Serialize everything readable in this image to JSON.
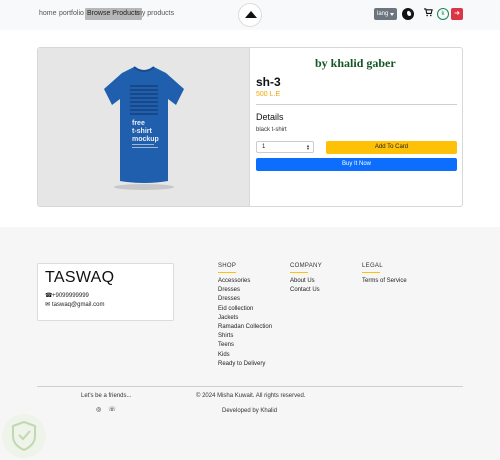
{
  "nav": {
    "links": [
      "home",
      "portfolio",
      "Browse Products",
      "my products"
    ],
    "lang_label": "lang",
    "k_label": "k"
  },
  "product": {
    "seller": "by khalid gaber",
    "title": "sh-3",
    "price": "500 L.E",
    "details_heading": "Details",
    "description": "black t-shirt",
    "quantity": "1",
    "add_to_cart": "Add To Card",
    "buy_now": "Buy It Now",
    "image_text": "free t-shirt mockup"
  },
  "footer": {
    "brand": "TASWAQ",
    "phone": "+9099999999",
    "email": "taswaq@gmail.com",
    "shop": {
      "heading": "SHOP",
      "items": [
        "Accessories",
        "Dresses",
        "Dresses",
        "Eid collection",
        "Jackets",
        "Ramadan Collection",
        "Shirts",
        "Teens",
        "Kids",
        "Ready to Delivery"
      ]
    },
    "company": {
      "heading": "COMPANY",
      "items": [
        "About Us",
        "Contact Us"
      ]
    },
    "legal": {
      "heading": "LEGAL",
      "items": [
        "Terms of Service"
      ]
    },
    "friends": "Let's be a friends...",
    "copyright": "© 2024 Misha Kuwait. All rights reserved.",
    "developed_by": "Developed by Khalid"
  },
  "colors": {
    "accent_yellow": "#ffc107",
    "primary_blue": "#0d6efd",
    "seller_green": "#155724",
    "price_orange": "#f0a500",
    "logout_red": "#dc3545"
  }
}
